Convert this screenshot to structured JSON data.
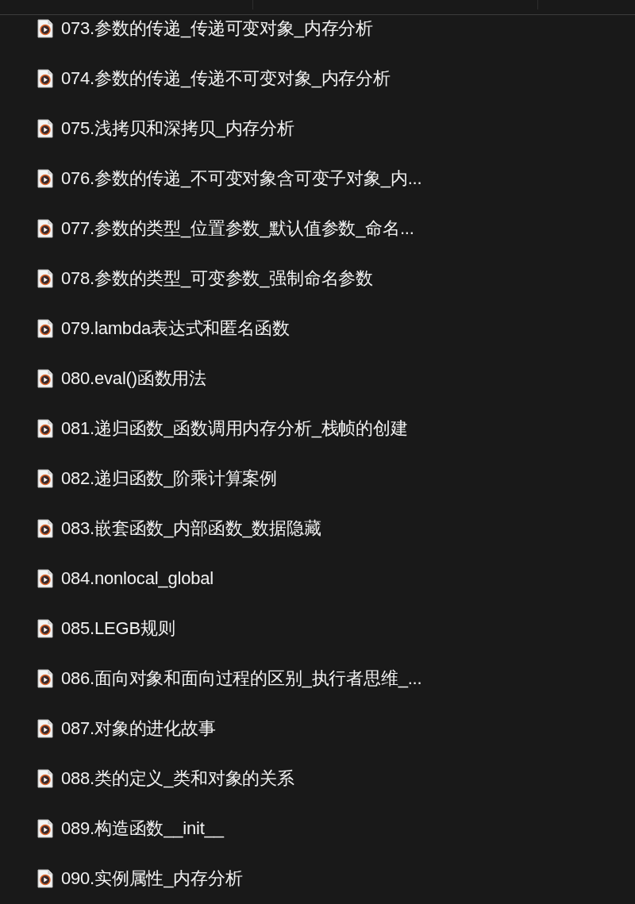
{
  "files": [
    {
      "name": "073.参数的传递_传递可变对象_内存分析"
    },
    {
      "name": "074.参数的传递_传递不可变对象_内存分析"
    },
    {
      "name": "075.浅拷贝和深拷贝_内存分析"
    },
    {
      "name": "076.参数的传递_不可变对象含可变子对象_内..."
    },
    {
      "name": "077.参数的类型_位置参数_默认值参数_命名..."
    },
    {
      "name": "078.参数的类型_可变参数_强制命名参数"
    },
    {
      "name": "079.lambda表达式和匿名函数"
    },
    {
      "name": "080.eval()函数用法"
    },
    {
      "name": "081.递归函数_函数调用内存分析_栈帧的创建"
    },
    {
      "name": "082.递归函数_阶乘计算案例"
    },
    {
      "name": "083.嵌套函数_内部函数_数据隐藏"
    },
    {
      "name": "084.nonlocal_global"
    },
    {
      "name": "085.LEGB规则"
    },
    {
      "name": "086.面向对象和面向过程的区别_执行者思维_..."
    },
    {
      "name": "087.对象的进化故事"
    },
    {
      "name": "088.类的定义_类和对象的关系"
    },
    {
      "name": "089.构造函数__init__"
    },
    {
      "name": "090.实例属性_内存分析"
    }
  ]
}
